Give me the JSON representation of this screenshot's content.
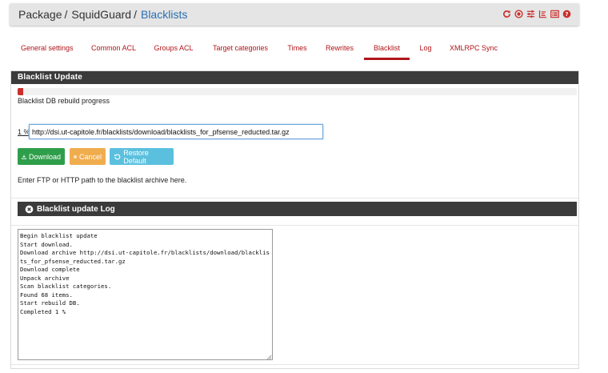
{
  "breadcrumb": {
    "items": [
      {
        "label": "Package",
        "sep": "/"
      },
      {
        "label": "SquidGuard",
        "sep": "/"
      },
      {
        "label": "Blacklists",
        "sep": ""
      }
    ]
  },
  "header_tools": [
    {
      "icon": "reload-icon",
      "color": "#c9302c"
    },
    {
      "icon": "stop-circle-icon",
      "color": "#c9302c"
    },
    {
      "icon": "sliders-icon",
      "color": "#c9302c"
    },
    {
      "icon": "bar-list-icon",
      "color": "#c9302c"
    },
    {
      "icon": "list-alt-icon",
      "color": "#c9302c"
    },
    {
      "icon": "help-icon",
      "color": "#c9302c"
    }
  ],
  "tabs": [
    {
      "label": "General settings",
      "active": false
    },
    {
      "label": "Common ACL",
      "active": false
    },
    {
      "label": "Groups ACL",
      "active": false
    },
    {
      "label": "Target categories",
      "active": false
    },
    {
      "label": "Times",
      "active": false
    },
    {
      "label": "Rewrites",
      "active": false
    },
    {
      "label": "Blacklist",
      "active": true
    },
    {
      "label": "Log",
      "active": false
    },
    {
      "label": "XMLRPC Sync",
      "active": false
    }
  ],
  "panel": {
    "title": "Blacklist Update",
    "progress_label": "Blacklist DB rebuild progress",
    "progress_value": 0.01,
    "percent_text": "1 %",
    "url_value": "http://dsi.ut-capitole.fr/blacklists/download/blacklists_for_pfsense_reducted.tar.gz",
    "buttons": {
      "download": "Download",
      "cancel": "Cancel",
      "restore": "Restore Default"
    },
    "hint": "Enter FTP or HTTP path to the blacklist archive here."
  },
  "log_panel": {
    "title": "Blacklist update Log",
    "text": "Begin blacklist update\nStart download.\nDownload archive http://dsi.ut-capitole.fr/blacklists/download/blacklists_for_pfsense_reducted.tar.gz\nDownload complete\nUnpack archive\nScan blacklist categories.\nFound 68 items.\nStart rebuild DB.\nCompleted 1 %"
  },
  "colors": {
    "accent": "#b0151a",
    "download": "#2e9e4a",
    "cancel": "#f0ad4e",
    "restore": "#5bc0de",
    "panel_head": "#3b3b3b"
  }
}
